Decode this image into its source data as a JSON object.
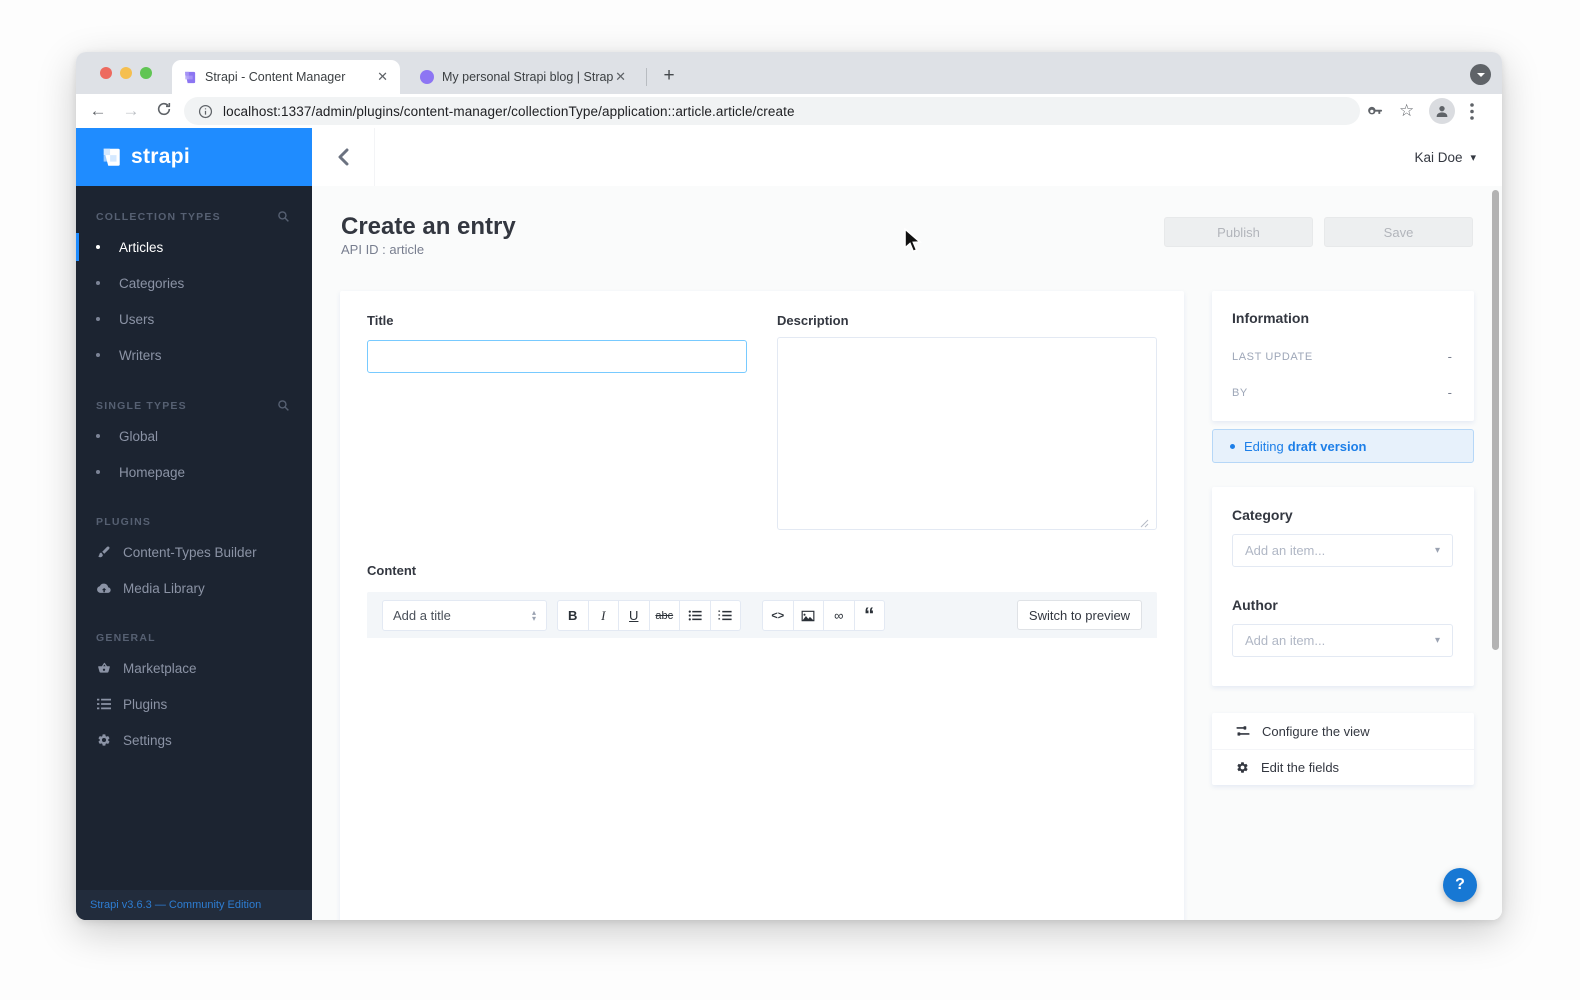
{
  "browser": {
    "tabs": [
      {
        "title": "Strapi - Content Manager",
        "close": "✕"
      },
      {
        "title": "My personal Strapi blog | Strap",
        "close": "✕"
      }
    ],
    "new_tab": "+",
    "url": "localhost:1337/admin/plugins/content-manager/collectionType/application::article.article/create"
  },
  "sidebar": {
    "logo_text": "strapi",
    "sections": [
      {
        "heading": "COLLECTION TYPES",
        "items": [
          {
            "label": "Articles"
          },
          {
            "label": "Categories"
          },
          {
            "label": "Users"
          },
          {
            "label": "Writers"
          }
        ]
      },
      {
        "heading": "SINGLE TYPES",
        "items": [
          {
            "label": "Global"
          },
          {
            "label": "Homepage"
          }
        ]
      },
      {
        "heading": "PLUGINS",
        "items": [
          {
            "label": "Content-Types Builder"
          },
          {
            "label": "Media Library"
          }
        ]
      },
      {
        "heading": "GENERAL",
        "items": [
          {
            "label": "Marketplace"
          },
          {
            "label": "Plugins"
          },
          {
            "label": "Settings"
          }
        ]
      }
    ],
    "footer": "Strapi v3.6.3 — Community Edition"
  },
  "header": {
    "user": "Kai Doe",
    "caret": "▾"
  },
  "page": {
    "title": "Create an entry",
    "subtitle": "API ID : article",
    "publish_label": "Publish",
    "save_label": "Save"
  },
  "form": {
    "title_label": "Title",
    "description_label": "Description",
    "content_label": "Content"
  },
  "editor": {
    "title_select": "Add a title",
    "format_buttons": [
      "B",
      "I",
      "U",
      "abc"
    ],
    "code_glyph": "<>",
    "link_glyph": "∞",
    "quote_glyph": "“",
    "switch_label": "Switch to preview"
  },
  "info_panel": {
    "heading": "Information",
    "rows": [
      {
        "label": "LAST UPDATE",
        "value": "-"
      },
      {
        "label": "BY",
        "value": "-"
      }
    ],
    "draft_prefix": "Editing",
    "draft_bold": "draft version"
  },
  "relations": {
    "category_label": "Category",
    "author_label": "Author",
    "placeholder": "Add an item..."
  },
  "view_links": [
    {
      "label": "Configure the view"
    },
    {
      "label": "Edit the fields"
    }
  ],
  "help_label": "?",
  "colors": {
    "accent_blue": "#1f8cff",
    "sidebar_bg": "#1c2431",
    "draft_banner_bg": "#e7f1fb",
    "draft_text": "#1d7fe8",
    "focus_border": "#78caff"
  }
}
